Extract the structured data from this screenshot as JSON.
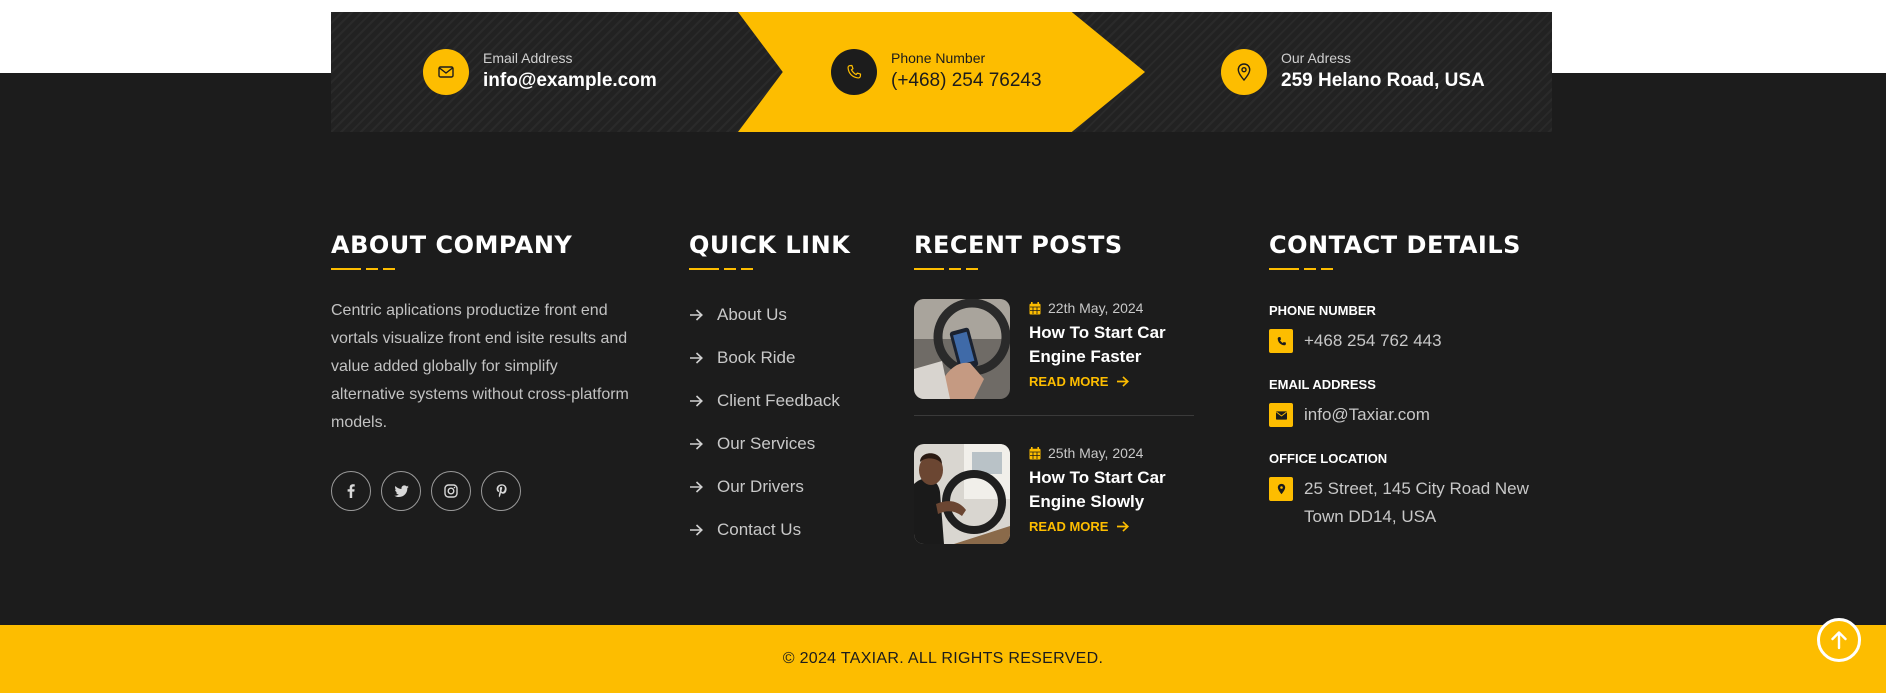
{
  "colors": {
    "accent": "#fdbd00",
    "dark": "#1c1c1c"
  },
  "contact_strip": [
    {
      "icon": "envelope-icon",
      "label": "Email Address",
      "value": "info@example.com"
    },
    {
      "icon": "phone-icon",
      "label": "Phone Number",
      "value": "(+468) 254 76243"
    },
    {
      "icon": "location-pin-icon",
      "label": "Our Adress",
      "value": "259 Helano Road, USA"
    }
  ],
  "about": {
    "title": "ABOUT COMPANY",
    "text": "Centric aplications productize front end vortals visualize front end isite results and value added globally for simplify alternative systems without cross-platform models.",
    "socials": [
      "facebook-icon",
      "twitter-icon",
      "instagram-icon",
      "pinterest-icon"
    ]
  },
  "quick_link": {
    "title": "QUICK LINK",
    "items": [
      "About Us",
      "Book Ride",
      "Client Feedback",
      "Our Services",
      "Our Drivers",
      "Contact Us"
    ]
  },
  "recent_posts": {
    "title": "RECENT POSTS",
    "items": [
      {
        "date": "22th May, 2024",
        "title": "How To Start Car Engine Faster",
        "read_more": "READ MORE"
      },
      {
        "date": "25th May, 2024",
        "title": "How To Start Car Engine Slowly",
        "read_more": "READ MORE"
      }
    ]
  },
  "contact_details": {
    "title": "CONTACT DETAILS",
    "phone_label": "PHONE NUMBER",
    "phone": "+468 254 762 443",
    "email_label": "EMAIL ADDRESS",
    "email": "info@Taxiar.com",
    "office_label": "OFFICE LOCATION",
    "office": "25 Street, 145 City Road New Town DD14, USA"
  },
  "footer": {
    "copyright": "© 2024 TAXIAR. ALL RIGHTS RESERVED."
  }
}
